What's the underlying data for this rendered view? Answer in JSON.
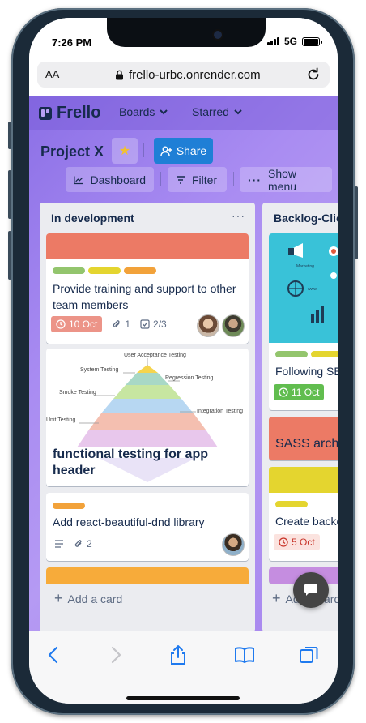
{
  "status": {
    "time": "7:26 PM",
    "network": "5G"
  },
  "browser": {
    "aa": "AA",
    "url": "frello-urbc.onrender.com"
  },
  "nav": {
    "logo": "Frello",
    "boards": "Boards",
    "starred": "Starred"
  },
  "board": {
    "title": "Project X",
    "share": "Share",
    "dashboard": "Dashboard",
    "filter": "Filter",
    "show_menu": "Show menu"
  },
  "lists": [
    {
      "title": "In development",
      "menu": "···",
      "add_card": "Add a card",
      "cards": [
        {
          "title": "Provide training and support to other team members",
          "due": "10 Oct",
          "attachments": "1",
          "checklist": "2/3"
        },
        {
          "title": "functional testing for app header",
          "pyramid": {
            "top": "User Acceptance Testing",
            "system": "System Testing",
            "regression": "Regression Testing",
            "smoke": "Smoke Testing",
            "integration": "Integration Testing",
            "unit": "Unit Testing"
          }
        },
        {
          "title": "Add react-beautiful-dnd library",
          "attachments": "2"
        }
      ]
    },
    {
      "title": "Backlog-Clie",
      "add_card": "Add a card",
      "cards": [
        {
          "title": "Following SEO",
          "due": "11 Oct",
          "cover_text": [
            "Marketing",
            "www"
          ]
        },
        {
          "title": "SASS archit"
        },
        {
          "title": "Create backe",
          "due": "5 Oct"
        }
      ]
    }
  ],
  "colors": {
    "board_bg": "#a98cf2",
    "label_green": "#93c56d",
    "label_yellow": "#e4d52f",
    "label_orange": "#f2a23a",
    "cover_red": "#ec7a65",
    "cover_orange": "#f7ab3a",
    "share_blue": "#1f7fd6"
  }
}
